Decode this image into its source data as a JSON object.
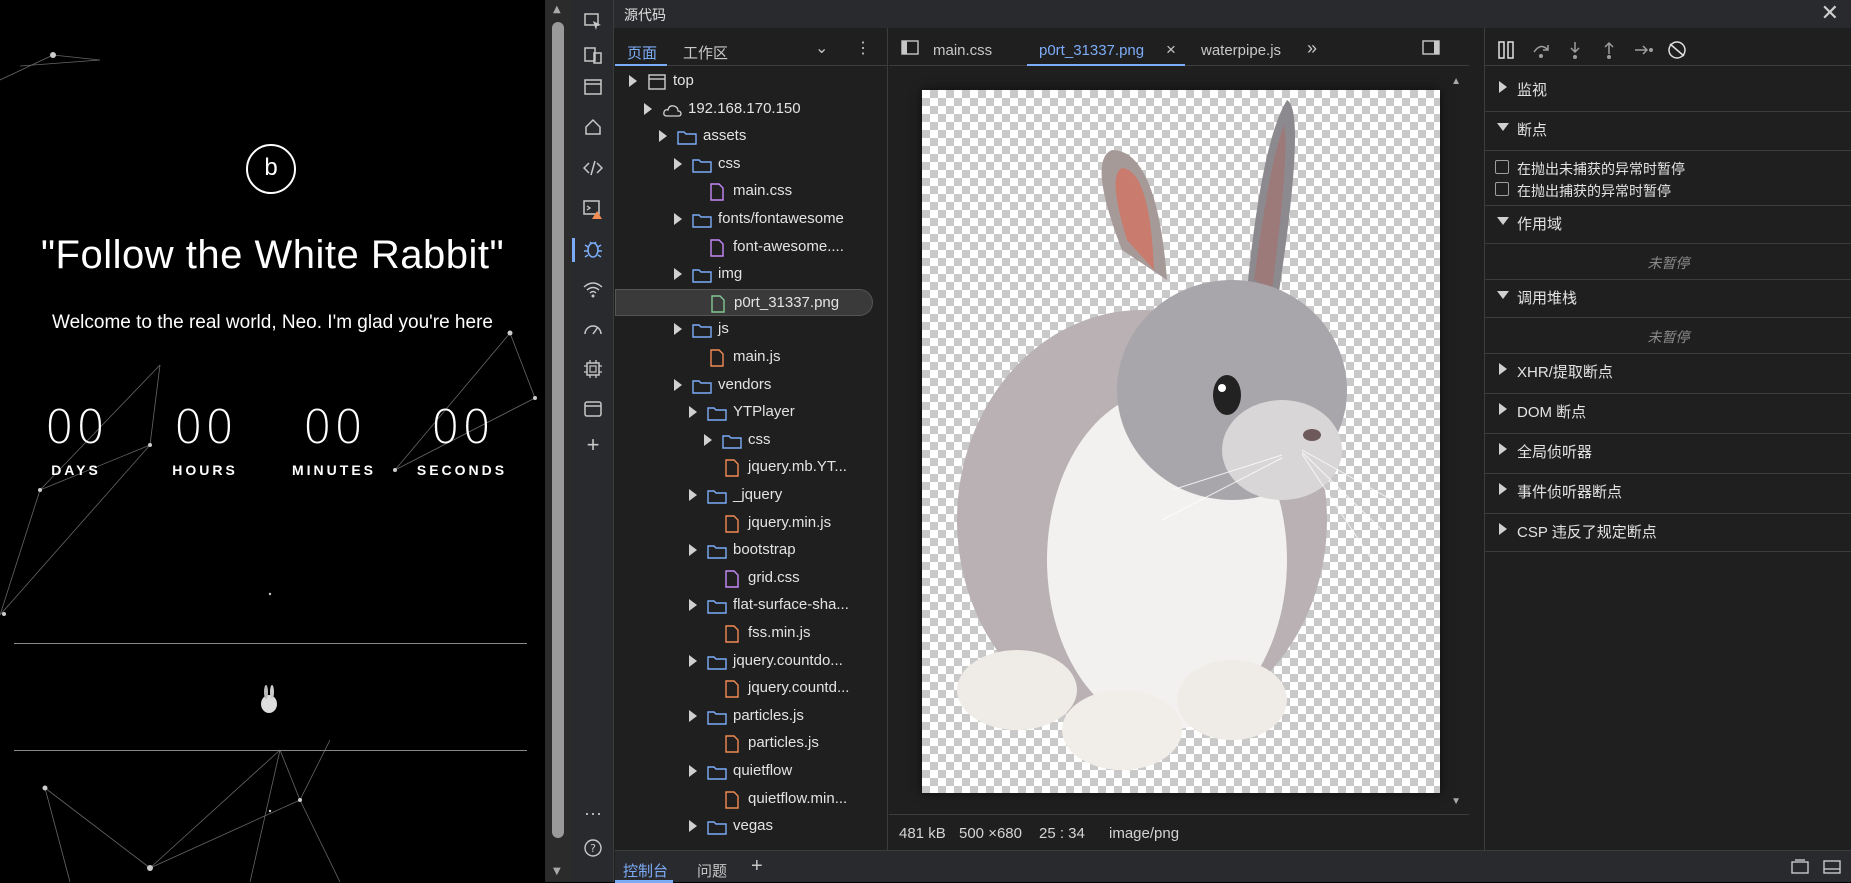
{
  "page": {
    "logo_letter": "b",
    "headline": "\"Follow the White Rabbit\"",
    "subheadline": "Welcome to the real world, Neo. I'm glad you're here",
    "countdown": [
      {
        "value": "00",
        "label": "DAYS"
      },
      {
        "value": "00",
        "label": "HOURS"
      },
      {
        "value": "00",
        "label": "MINUTES"
      },
      {
        "value": "00",
        "label": "SECONDS"
      }
    ]
  },
  "devtools": {
    "panel_title": "源代码",
    "nav_tabs": {
      "page": "页面",
      "workspace": "工作区"
    },
    "tree": [
      {
        "label": "top",
        "type": "frame"
      },
      {
        "label": "192.168.170.150",
        "type": "cloud"
      },
      {
        "label": "assets",
        "type": "folder"
      },
      {
        "label": "css",
        "type": "folder"
      },
      {
        "label": "main.css",
        "type": "css"
      },
      {
        "label": "fonts/fontawesome",
        "type": "folder"
      },
      {
        "label": "font-awesome....",
        "type": "css"
      },
      {
        "label": "img",
        "type": "folder"
      },
      {
        "label": "p0rt_31337.png",
        "type": "img"
      },
      {
        "label": "js",
        "type": "folder"
      },
      {
        "label": "main.js",
        "type": "js"
      },
      {
        "label": "vendors",
        "type": "folder"
      },
      {
        "label": "YTPlayer",
        "type": "folder"
      },
      {
        "label": "css",
        "type": "folder"
      },
      {
        "label": "jquery.mb.YT...",
        "type": "js"
      },
      {
        "label": "_jquery",
        "type": "folder"
      },
      {
        "label": "jquery.min.js",
        "type": "js"
      },
      {
        "label": "bootstrap",
        "type": "folder"
      },
      {
        "label": "grid.css",
        "type": "css"
      },
      {
        "label": "flat-surface-sha...",
        "type": "folder"
      },
      {
        "label": "fss.min.js",
        "type": "js"
      },
      {
        "label": "jquery.countdo...",
        "type": "folder"
      },
      {
        "label": "jquery.countd...",
        "type": "js"
      },
      {
        "label": "particles.js",
        "type": "folder"
      },
      {
        "label": "particles.js",
        "type": "js"
      },
      {
        "label": "quietflow",
        "type": "folder"
      },
      {
        "label": "quietflow.min...",
        "type": "js"
      },
      {
        "label": "vegas",
        "type": "folder"
      }
    ],
    "editor_tabs": [
      "main.css",
      "p0rt_31337.png",
      "waterpipe.js"
    ],
    "status": {
      "size": "481 kB",
      "dimensions": "500 ×680",
      "ratio": "25 : 34",
      "mime": "image/png"
    },
    "debugger": {
      "watch": "监视",
      "breakpoints": "断点",
      "pause_uncaught": "在抛出未捕获的异常时暂停",
      "pause_caught": "在抛出捕获的异常时暂停",
      "scope": "作用域",
      "not_paused_1": "未暂停",
      "call_stack": "调用堆栈",
      "not_paused_2": "未暂停",
      "xhr": "XHR/提取断点",
      "dom": "DOM 断点",
      "global": "全局侦听器",
      "event": "事件侦听器断点",
      "csp": "CSP 违反了规定断点"
    },
    "drawer_tabs": {
      "console": "控制台",
      "issues": "问题",
      "add": "+"
    }
  }
}
